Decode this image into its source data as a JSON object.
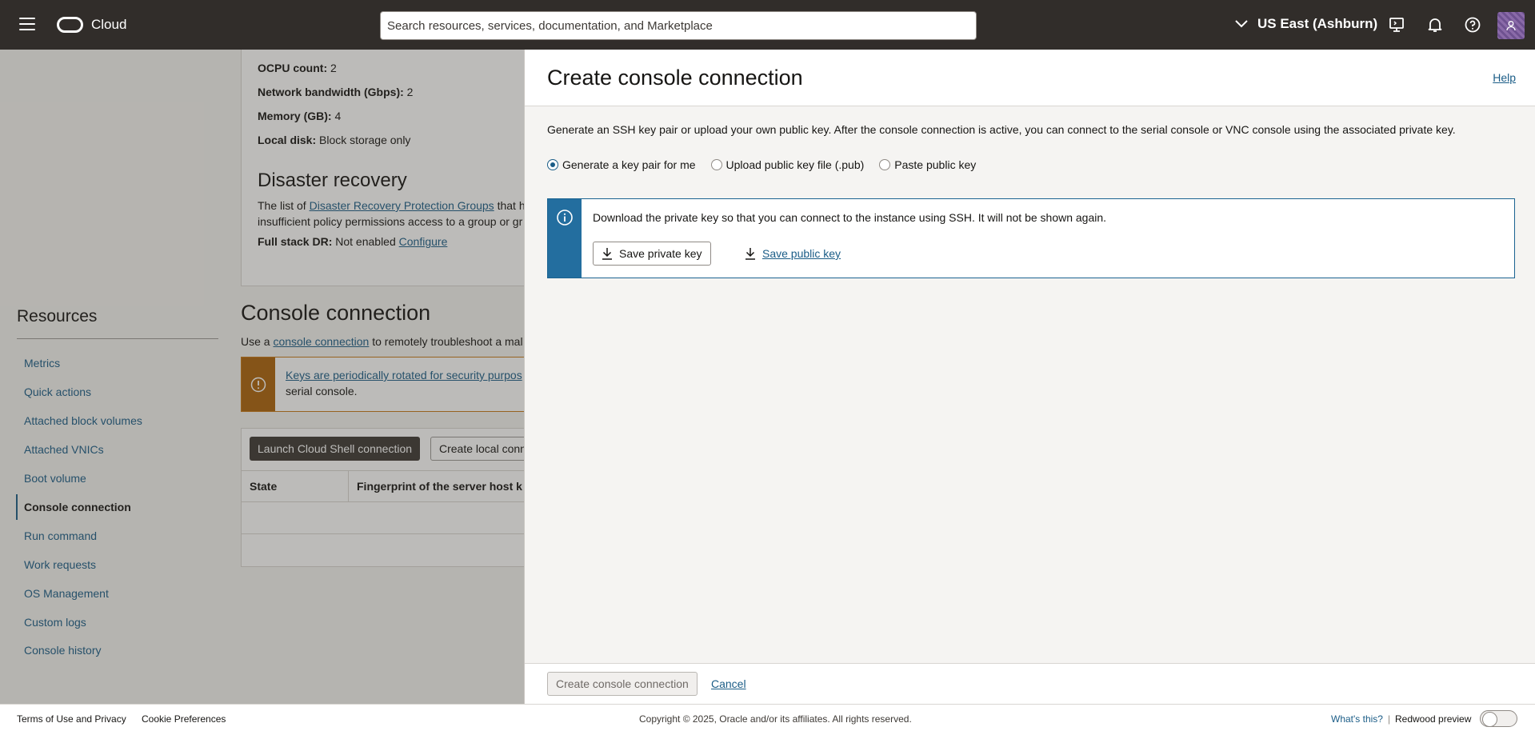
{
  "topbar": {
    "brand": "Cloud",
    "search_placeholder": "Search resources, services, documentation, and Marketplace",
    "region": "US East (Ashburn)"
  },
  "details": {
    "ocpu_label": "OCPU count:",
    "ocpu_value": "2",
    "bandwidth_label": "Network bandwidth (Gbps):",
    "bandwidth_value": "2",
    "memory_label": "Memory (GB):",
    "memory_value": "4",
    "disk_label": "Local disk:",
    "disk_value": "Block storage only"
  },
  "disaster_recovery": {
    "title": "Disaster recovery",
    "text_prefix": "The list of ",
    "link": "Disaster Recovery Protection Groups",
    "text_suffix": " that h",
    "line2": "insufficient policy permissions access to a group or gr",
    "full_stack_label": "Full stack DR:",
    "full_stack_value": "Not enabled",
    "configure": "Configure"
  },
  "resources": {
    "title": "Resources",
    "items": [
      {
        "label": "Metrics"
      },
      {
        "label": "Quick actions"
      },
      {
        "label": "Attached block volumes"
      },
      {
        "label": "Attached VNICs"
      },
      {
        "label": "Boot volume"
      },
      {
        "label": "Console connection"
      },
      {
        "label": "Run command"
      },
      {
        "label": "Work requests"
      },
      {
        "label": "OS Management"
      },
      {
        "label": "Custom logs"
      },
      {
        "label": "Console history"
      }
    ]
  },
  "console_section": {
    "title": "Console connection",
    "desc_prefix": "Use a ",
    "desc_link": "console connection",
    "desc_suffix": " to remotely troubleshoot a mal",
    "warning_link": "Keys are periodically rotated for security purpos",
    "warning_line2": "serial console.",
    "launch_button": "Launch Cloud Shell connection",
    "create_local_button": "Create local conn",
    "col_state": "State",
    "col_fingerprint": "Fingerprint of the server host k"
  },
  "panel": {
    "title": "Create console connection",
    "help": "Help",
    "description": "Generate an SSH key pair or upload your own public key. After the console connection is active, you can connect to the serial console or VNC console using the associated private key.",
    "radio_options": [
      {
        "label": "Generate a key pair for me",
        "selected": true
      },
      {
        "label": "Upload public key file (.pub)",
        "selected": false
      },
      {
        "label": "Paste public key",
        "selected": false
      }
    ],
    "info_text": "Download the private key so that you can connect to the instance using SSH. It will not be shown again.",
    "save_private": "Save private key",
    "save_public": "Save public key",
    "create_button": "Create console connection",
    "cancel": "Cancel"
  },
  "footer": {
    "terms": "Terms of Use and Privacy",
    "cookies": "Cookie Preferences",
    "copyright": "Copyright © 2025, Oracle and/or its affiliates. All rights reserved.",
    "whats_this": "What's this?",
    "separator": "|",
    "redwood": "Redwood preview"
  },
  "colors": {
    "topbar": "#312d2a",
    "link": "#1b5d87",
    "info_accent": "#236e9f",
    "warning_accent": "#ac630c"
  }
}
